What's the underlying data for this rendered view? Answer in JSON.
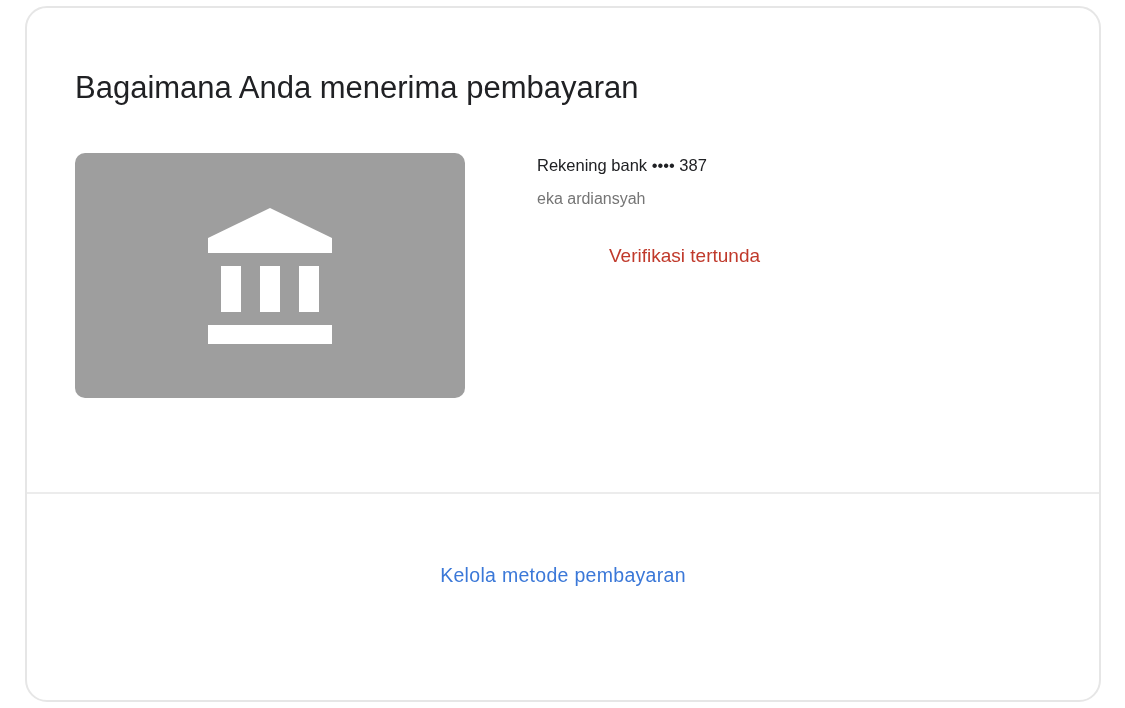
{
  "title": "Bagaimana Anda menerima pembayaran",
  "account": {
    "label": "Rekening bank •••• 387",
    "holder": "eka ardiansyah",
    "status": "Verifikasi tertunda"
  },
  "link": "Kelola metode pembayaran"
}
